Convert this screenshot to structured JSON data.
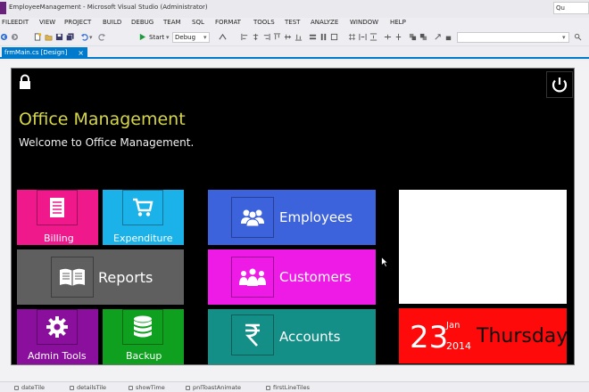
{
  "window": {
    "title": "EmployeeManagement - Microsoft Visual Studio (Administrator)",
    "quick_launch": "Qu"
  },
  "menu": [
    "FILE",
    "EDIT",
    "VIEW",
    "PROJECT",
    "BUILD",
    "DEBUG",
    "TEAM",
    "SQL",
    "FORMAT",
    "TOOLS",
    "TEST",
    "ANALYZE",
    "WINDOW",
    "HELP"
  ],
  "toolbar": {
    "start_label": "Start",
    "config_value": "Debug"
  },
  "document_tab": {
    "label": "frmMain.cs [Design]",
    "close": "×"
  },
  "app": {
    "title": "Office Management",
    "welcome": "Welcome to Office Management.",
    "tiles": {
      "billing": "Billing",
      "expenditure": "Expenditure",
      "reports": "Reports",
      "admin_tools": "Admin Tools",
      "backup": "Backup",
      "employees": "Employees",
      "customers": "Customers",
      "accounts": "Accounts"
    },
    "date": {
      "day": "23",
      "month": "Jan",
      "year": "2014",
      "weekday": "Thursday"
    }
  },
  "component_tray": [
    "dateTile",
    "detailsTile",
    "showTime",
    "pnlToastAnimate",
    "firstLineTiles"
  ],
  "colors": {
    "vs_accent": "#007acc",
    "billing": "#f0198c",
    "expenditure": "#1ab2e8",
    "reports": "#5f5f5f",
    "admin_tools": "#8a0f9c",
    "backup": "#10a020",
    "employees": "#3d63dc",
    "customers": "#ee1ae6",
    "accounts": "#138f87",
    "date": "#ff0a0a",
    "title": "#d6d64a"
  }
}
